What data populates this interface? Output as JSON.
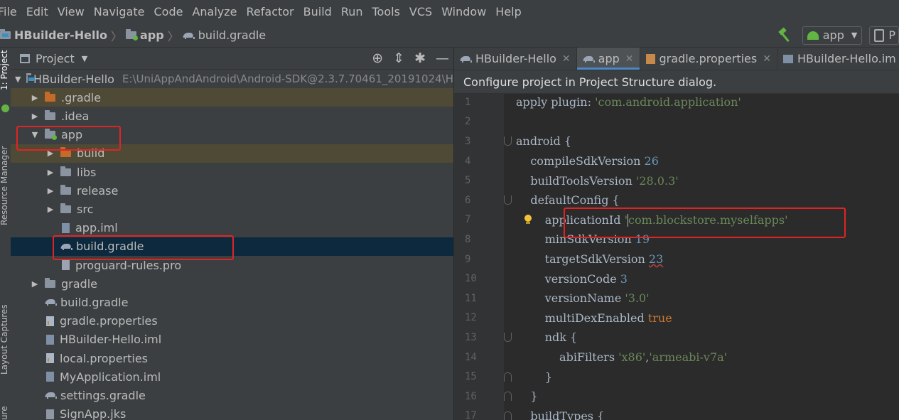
{
  "menu": [
    "File",
    "Edit",
    "View",
    "Navigate",
    "Code",
    "Analyze",
    "Refactor",
    "Build",
    "Run",
    "Tools",
    "VCS",
    "Window",
    "Help"
  ],
  "breadcrumbs": {
    "project": "HBuilder-Hello",
    "module": "app",
    "file": "build.gradle"
  },
  "run_config": {
    "label": "app"
  },
  "left_strip": {
    "project_tab": "1: Project",
    "resource_manager": "Resource Manager",
    "layout_captures": "Layout Captures",
    "structure": "ure"
  },
  "project_panel": {
    "title": "Project",
    "tree": [
      {
        "label": "HBuilder-Hello",
        "path": "E:\\UniAppAndAndroid\\Android-SDK@2.3.7.70461_20191024\\H",
        "depth": 0,
        "expanded": true,
        "icon": "module-icon",
        "bold": false
      },
      {
        "label": ".gradle",
        "depth": 1,
        "expanded": false,
        "icon": "folder-excluded-icon"
      },
      {
        "label": ".idea",
        "depth": 1,
        "expanded": false,
        "icon": "folder-icon"
      },
      {
        "label": "app",
        "depth": 1,
        "expanded": true,
        "icon": "module-folder-icon"
      },
      {
        "label": "build",
        "depth": 2,
        "expanded": false,
        "icon": "folder-excluded-icon"
      },
      {
        "label": "libs",
        "depth": 2,
        "expanded": false,
        "icon": "folder-icon"
      },
      {
        "label": "release",
        "depth": 2,
        "expanded": false,
        "icon": "folder-icon"
      },
      {
        "label": "src",
        "depth": 2,
        "expanded": false,
        "icon": "folder-icon"
      },
      {
        "label": "app.iml",
        "depth": 2,
        "icon": "iml-file-icon"
      },
      {
        "label": "build.gradle",
        "depth": 2,
        "icon": "gradle-icon"
      },
      {
        "label": "proguard-rules.pro",
        "depth": 2,
        "icon": "text-file-icon"
      },
      {
        "label": "gradle",
        "depth": 1,
        "expanded": false,
        "icon": "folder-icon"
      },
      {
        "label": "build.gradle",
        "depth": 1,
        "icon": "gradle-icon"
      },
      {
        "label": "gradle.properties",
        "depth": 1,
        "icon": "properties-file-icon"
      },
      {
        "label": "HBuilder-Hello.iml",
        "depth": 1,
        "icon": "iml-file-icon"
      },
      {
        "label": "local.properties",
        "depth": 1,
        "icon": "properties-file-icon"
      },
      {
        "label": "MyApplication.iml",
        "depth": 1,
        "icon": "iml-file-icon"
      },
      {
        "label": "settings.gradle",
        "depth": 1,
        "icon": "gradle-icon"
      },
      {
        "label": "SignApp.jks",
        "depth": 1,
        "icon": "keystore-file-icon"
      }
    ]
  },
  "editor": {
    "tabs": [
      {
        "label": "HBuilder-Hello",
        "icon": "gradle-icon",
        "active": false
      },
      {
        "label": "app",
        "icon": "gradle-icon",
        "active": true
      },
      {
        "label": "gradle.properties",
        "icon": "properties-file-icon",
        "active": false
      },
      {
        "label": "HBuilder-Hello.im",
        "icon": "iml-file-icon",
        "active": false
      }
    ],
    "banner": "Configure project in Project Structure dialog.",
    "lines": [
      {
        "n": "1",
        "tokens": [
          [
            "p",
            "apply plugin: "
          ],
          [
            "s",
            "'com.android.application'"
          ]
        ]
      },
      {
        "n": "2",
        "tokens": []
      },
      {
        "n": "3",
        "tokens": [
          [
            "p",
            "android {"
          ]
        ]
      },
      {
        "n": "4",
        "tokens": [
          [
            "p",
            "    compileSdkVersion "
          ],
          [
            "n",
            "26"
          ]
        ]
      },
      {
        "n": "5",
        "tokens": [
          [
            "p",
            "    buildToolsVersion "
          ],
          [
            "s",
            "'28.0.3'"
          ]
        ]
      },
      {
        "n": "6",
        "tokens": [
          [
            "p",
            "    defaultConfig {"
          ]
        ]
      },
      {
        "n": "7",
        "tokens": [
          [
            "p",
            "        applicationId "
          ],
          [
            "s",
            "'"
          ],
          [
            "c",
            ""
          ],
          [
            "s",
            "com.blockstore.myselfapps'"
          ]
        ]
      },
      {
        "n": "8",
        "tokens": [
          [
            "p",
            "        minSdkVersion "
          ],
          [
            "n",
            "19"
          ]
        ]
      },
      {
        "n": "9",
        "tokens": [
          [
            "p",
            "        targetSdkVersion "
          ],
          [
            "w",
            "23"
          ]
        ]
      },
      {
        "n": "10",
        "tokens": [
          [
            "p",
            "        versionCode "
          ],
          [
            "n",
            "3"
          ]
        ]
      },
      {
        "n": "11",
        "tokens": [
          [
            "p",
            "        versionName "
          ],
          [
            "s",
            "'3.0'"
          ]
        ]
      },
      {
        "n": "12",
        "tokens": [
          [
            "p",
            "        multiDexEnabled "
          ],
          [
            "k",
            "true"
          ]
        ]
      },
      {
        "n": "13",
        "tokens": [
          [
            "p",
            "        ndk {"
          ]
        ]
      },
      {
        "n": "14",
        "tokens": [
          [
            "p",
            "            abiFilters "
          ],
          [
            "s",
            "'x86'"
          ],
          [
            "p",
            ","
          ],
          [
            "s",
            "'armeabi-v7a'"
          ]
        ]
      },
      {
        "n": "15",
        "tokens": [
          [
            "p",
            "        }"
          ]
        ]
      },
      {
        "n": "16",
        "tokens": [
          [
            "p",
            "    }"
          ]
        ]
      },
      {
        "n": "17",
        "tokens": [
          [
            "p",
            "    buildTypes {"
          ]
        ]
      }
    ]
  },
  "colors": {
    "highlight_box": "#e02424",
    "selection": "#0d293e",
    "excluded_row": "#4e4a36",
    "string": "#6a8759",
    "number": "#6897bb",
    "keyword": "#cc7832"
  }
}
